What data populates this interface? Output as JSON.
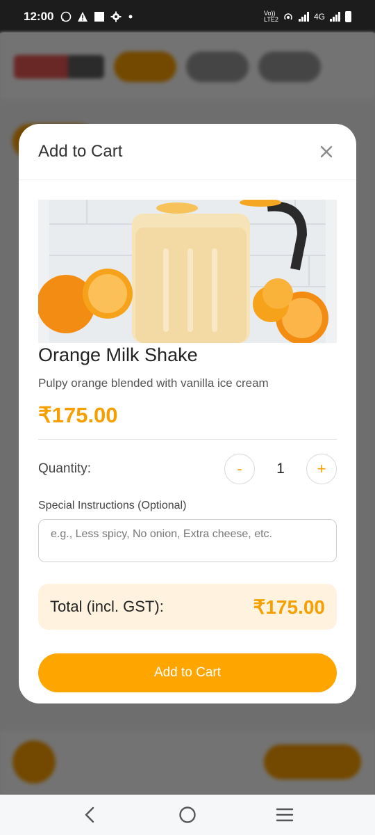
{
  "status_bar": {
    "time": "12:00",
    "network_label": "4G",
    "volte_label": "Vo)) LTE2"
  },
  "modal": {
    "title": "Add to Cart",
    "close_icon": "close-icon"
  },
  "product": {
    "name": "Orange Milk Shake",
    "description": "Pulpy orange blended with vanilla ice cream",
    "price": "₹175.00",
    "image_icon": "orange-milk-shake-image"
  },
  "quantity": {
    "label": "Quantity:",
    "value": "1",
    "decrement_label": "-",
    "increment_label": "+"
  },
  "instructions": {
    "label": "Special Instructions (Optional)",
    "placeholder": "e.g., Less spicy, No onion, Extra cheese, etc.",
    "value": ""
  },
  "total": {
    "label": "Total (incl. GST):",
    "value": "₹175.00"
  },
  "add_button_label": "Add to Cart",
  "colors": {
    "accent": "#ffa500",
    "price": "#f5a000",
    "total_bg": "#fff3e0"
  },
  "nav": {
    "back_icon": "back-icon",
    "home_icon": "home-icon",
    "recents_icon": "recents-icon"
  }
}
